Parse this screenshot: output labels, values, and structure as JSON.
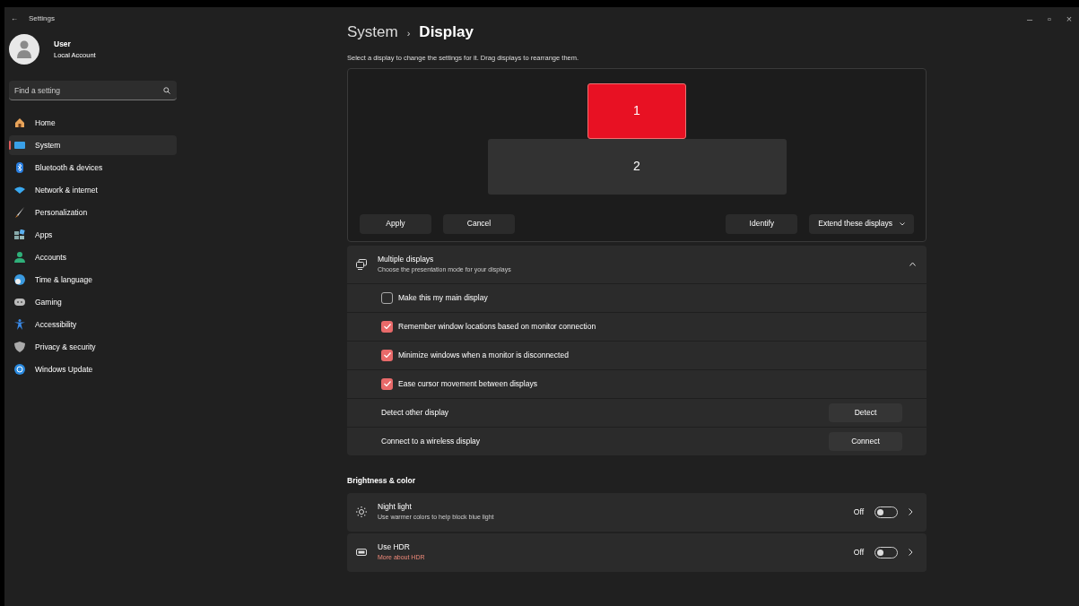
{
  "window": {
    "title": "Settings",
    "back": "←",
    "controls": [
      "–",
      "▫",
      "×"
    ]
  },
  "user": {
    "name": "User",
    "account": "Local Account"
  },
  "search": {
    "placeholder": "Find a setting"
  },
  "nav": [
    {
      "label": "Home",
      "selected": false
    },
    {
      "label": "System",
      "selected": true
    },
    {
      "label": "Bluetooth & devices",
      "selected": false
    },
    {
      "label": "Network & internet",
      "selected": false
    },
    {
      "label": "Personalization",
      "selected": false
    },
    {
      "label": "Apps",
      "selected": false
    },
    {
      "label": "Accounts",
      "selected": false
    },
    {
      "label": "Time & language",
      "selected": false
    },
    {
      "label": "Gaming",
      "selected": false
    },
    {
      "label": "Accessibility",
      "selected": false
    },
    {
      "label": "Privacy & security",
      "selected": false
    },
    {
      "label": "Windows Update",
      "selected": false
    }
  ],
  "breadcrumb": [
    "System",
    "›",
    "Display"
  ],
  "hint": "Select a display to change the settings for it. Drag displays to rearrange them.",
  "displays": [
    {
      "label": "1",
      "selected": true
    },
    {
      "label": "2",
      "selected": false
    }
  ],
  "arrangement_buttons": [
    {
      "label": "Apply",
      "kind": "button"
    },
    {
      "label": "Cancel",
      "kind": "button"
    },
    {
      "label": "Identify",
      "kind": "button"
    },
    {
      "label": "Extend these displays",
      "kind": "dropdown"
    }
  ],
  "multiple_displays": {
    "title": "Multiple displays",
    "subtitle": "Choose the presentation mode for your displays",
    "expanded": true,
    "options": [
      {
        "label": "Make this my main display",
        "checked": false
      },
      {
        "label": "Remember window locations based on monitor connection",
        "checked": true
      },
      {
        "label": "Minimize windows when a monitor is disconnected",
        "checked": true
      },
      {
        "label": "Ease cursor movement between displays",
        "checked": true
      }
    ],
    "actions": [
      {
        "label": "Detect other display",
        "button": "Detect"
      },
      {
        "label": "Connect to a wireless display",
        "button": "Connect"
      }
    ]
  },
  "brightness_heading": "Brightness & color",
  "settings": [
    {
      "title": "Night light",
      "subtitle": "Use warmer colors to help block blue light",
      "kind": "text",
      "state": "Off",
      "on": false
    },
    {
      "title": "Use HDR",
      "subtitle": "More about HDR",
      "kind": "link",
      "state": "Off",
      "on": false
    }
  ]
}
